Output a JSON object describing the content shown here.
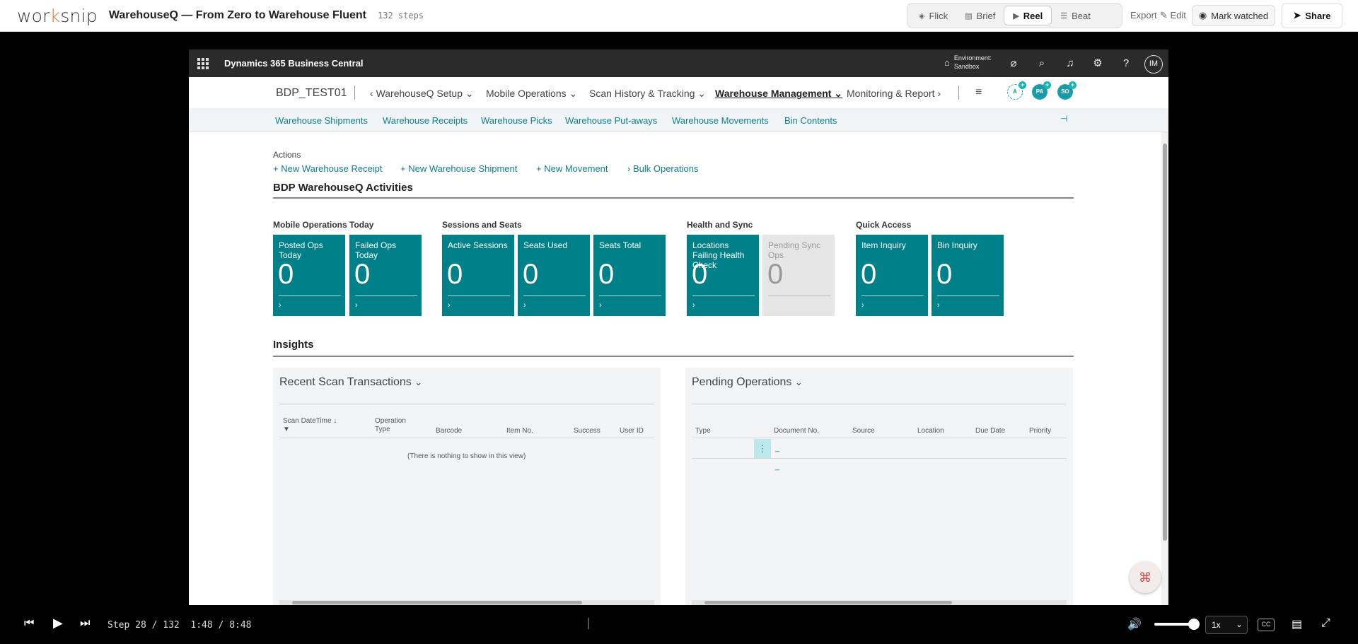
{
  "topbar": {
    "logo": "worksnip",
    "title": "WarehouseQ — From Zero to Warehouse Fluent",
    "steps": "132 steps",
    "modes": [
      "Flick",
      "Brief",
      "Reel",
      "Beat"
    ],
    "export": "Export",
    "edit": "Edit",
    "mark_watched": "Mark watched",
    "share": "Share"
  },
  "bc": {
    "title": "Dynamics 365 Business Central",
    "environment_label": "Environment:",
    "environment_value": "Sandbox",
    "user_initials": "IM",
    "company": "BDP_TEST01",
    "nav": [
      "WarehouseQ Setup",
      "Mobile Operations",
      "Scan History & Tracking",
      "Warehouse Management",
      "Monitoring & Report"
    ],
    "presence": [
      "A",
      "PA",
      "SO"
    ],
    "subnav": [
      "Warehouse Shipments",
      "Warehouse Receipts",
      "Warehouse Picks",
      "Warehouse Put-aways",
      "Warehouse Movements",
      "Bin Contents"
    ],
    "actions_label": "Actions",
    "actions": [
      "New Warehouse Receipt",
      "New Warehouse Shipment",
      "New Movement",
      "Bulk Operations"
    ],
    "activities_title": "BDP WarehouseQ Activities",
    "groups": [
      "Mobile Operations Today",
      "Sessions and Seats",
      "Health and Sync",
      "Quick Access"
    ],
    "tiles": [
      {
        "label": "Posted Ops Today",
        "value": "0"
      },
      {
        "label": "Failed Ops Today",
        "value": "0"
      },
      {
        "label": "Active Sessions",
        "value": "0"
      },
      {
        "label": "Seats Used",
        "value": "0"
      },
      {
        "label": "Seats Total",
        "value": "0"
      },
      {
        "label": "Locations Failing Health Check",
        "value": "0"
      },
      {
        "label": "Pending Sync Ops",
        "value": "0"
      },
      {
        "label": "Item Inquiry",
        "value": "0"
      },
      {
        "label": "Bin Inquiry",
        "value": "0"
      }
    ],
    "insights_title": "Insights",
    "scan_panel": {
      "title": "Recent Scan Transactions",
      "columns": [
        "Scan DateTime ↓",
        "Operation Type",
        "Barcode",
        "Item No.",
        "Success",
        "User ID"
      ],
      "empty": "(There is nothing to show in this view)"
    },
    "pending_panel": {
      "title": "Pending Operations",
      "columns": [
        "Type",
        "Document No.",
        "Source",
        "Location",
        "Due Date",
        "Priority"
      ],
      "rows": [
        "_",
        "_"
      ]
    }
  },
  "player": {
    "step": "Step 28 / 132",
    "time": "1:48 / 8:48",
    "speed": "1x",
    "cc": "CC"
  }
}
